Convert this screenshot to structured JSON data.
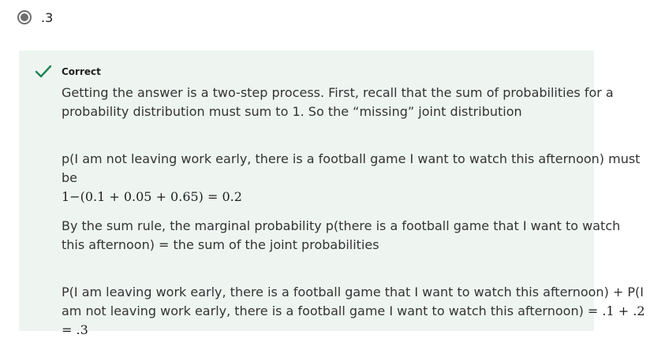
{
  "option": {
    "label": ".3",
    "selected": true
  },
  "feedback": {
    "status": "Correct",
    "icon": "check-icon",
    "accent_color": "#1f8354",
    "background_color": "#eef5f1",
    "paragraphs": {
      "p1": "Getting the answer is a two-step process. First, recall that the sum of probabilities for a probability distribution must sum to 1. So the “missing” joint distribution",
      "p2_text": "p(I am not leaving work early, there is a football game I want to watch this afternoon) must be",
      "p2_math": "1−(0.1 + 0.05 + 0.65) = 0.2",
      "p3": "By the sum rule, the marginal probability p(there is a football game that I want to watch this afternoon) = the sum of the joint probabilities",
      "p4_text": "P(I am leaving work early, there is a football game that I want to watch this afternoon) + P(I am not leaving work early, there is a football game I want to watch this afternoon) = ",
      "p4_math": ".1 + .2 = .3"
    }
  }
}
